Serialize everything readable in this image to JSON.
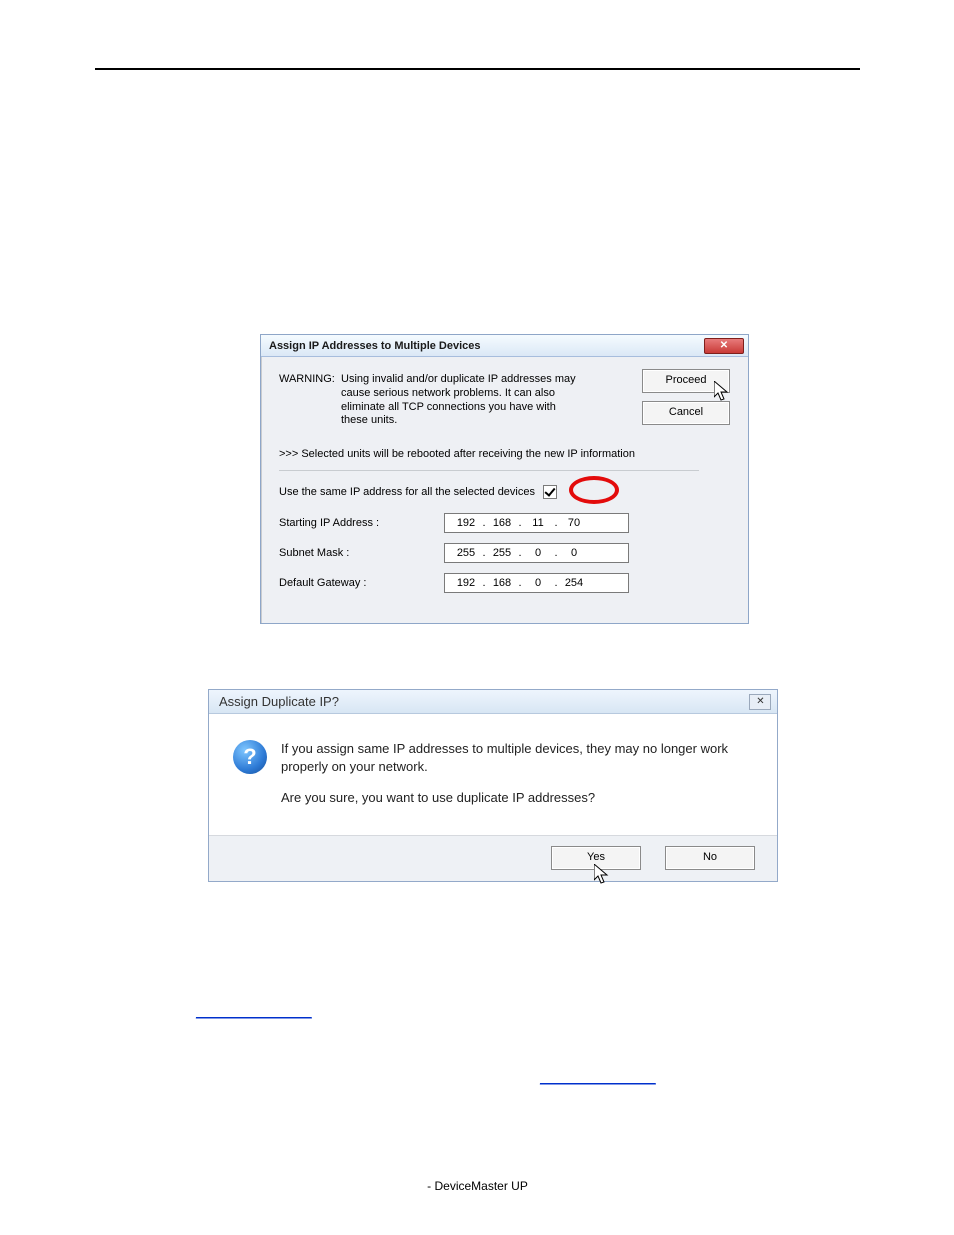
{
  "dialog1": {
    "title": "Assign IP Addresses to Multiple Devices",
    "close_label": "✕",
    "warn_label": "WARNING:",
    "warn_text": "Using invalid and/or duplicate IP addresses may cause serious network problems. It can also eliminate all TCP connections you have with these units.",
    "reboot_note": ">>> Selected units will be rebooted after receiving the new IP information",
    "same_ip_label": "Use the same IP address for all the selected devices",
    "starting_ip_label": "Starting IP Address :",
    "subnet_label": "Subnet Mask :",
    "gateway_label": "Default Gateway :",
    "ip": {
      "o1": "192",
      "o2": "168",
      "o3": "11",
      "o4": "70"
    },
    "mask": {
      "o1": "255",
      "o2": "255",
      "o3": "0",
      "o4": "0"
    },
    "gw": {
      "o1": "192",
      "o2": "168",
      "o3": "0",
      "o4": "254"
    },
    "proceed_label": "Proceed",
    "cancel_label": "Cancel"
  },
  "dialog2": {
    "title": "Assign Duplicate IP?",
    "close_glyph": "✕",
    "line1": "If you assign same IP addresses to multiple devices, they may no longer work properly on your network.",
    "line2": "Are you sure, you want to use duplicate IP addresses?",
    "yes_label": "Yes",
    "no_label": "No"
  },
  "links": {
    "a": "________________",
    "b": "________________"
  },
  "footer": "- DeviceMaster UP"
}
